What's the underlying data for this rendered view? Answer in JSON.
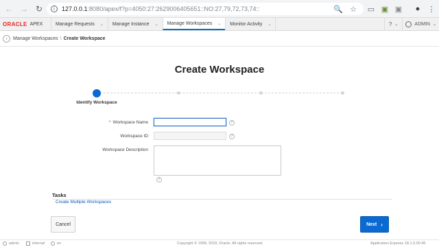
{
  "browser": {
    "back_icon": "arrow-left-icon",
    "back_glyph": "←",
    "forward_glyph": "→",
    "reload_glyph": "↻",
    "info_glyph": "i",
    "url_host": "127.0.0.1",
    "url_path": ":8080/apex/f?p=4050:27:2629006405651::NO:27,79,72,73,74::",
    "zoom_glyph": "🔍",
    "star_glyph": "☆",
    "cast_glyph": "▭",
    "ext1_glyph": "▣",
    "ext2_glyph": "▣",
    "account_glyph": "●",
    "menu_glyph": "⋮"
  },
  "header": {
    "logo_oracle": "ORACLE",
    "logo_apex": "APEX",
    "tabs": [
      {
        "label": "Manage Requests",
        "chevron": "⌄"
      },
      {
        "label": "Manage Instance",
        "chevron": "⌄"
      },
      {
        "label": "Manage Workspaces",
        "chevron": "⌄"
      },
      {
        "label": "Monitor Activity",
        "chevron": "⌄"
      }
    ],
    "active_tab_index": 2,
    "help_glyph": "?",
    "help_chevron": "⌄",
    "user_label": "ADMIN",
    "user_chevron": "⌄"
  },
  "breadcrumb": {
    "back_glyph": "‹",
    "parent": "Manage Workspaces",
    "separator": "\\",
    "current": "Create Workspace"
  },
  "page_title": "Create Workspace",
  "wizard": {
    "current_step_label": "Identify Workspace",
    "total_steps": 4,
    "current_step": 1
  },
  "form": {
    "required_mark": "*",
    "workspace_name_label": "Workspace Name",
    "workspace_name_value": "",
    "workspace_id_label": "Workspace ID",
    "workspace_id_value": "",
    "workspace_description_label": "Workspace Description",
    "help_glyph": "?"
  },
  "tasks": {
    "heading": "Tasks",
    "link": "Create Multiple Workspaces"
  },
  "buttons": {
    "cancel": "Cancel",
    "next": "Next",
    "next_arrow": "›"
  },
  "footer": {
    "user": "admin",
    "schema": "internal",
    "language": "en",
    "copyright": "Copyright © 1999, 2018, Oracle. All rights reserved.",
    "version": "Application Express 18.1.0.00.45"
  },
  "colors": {
    "accent": "#0a6ad2",
    "oracle_red": "#e42525",
    "required": "#d62c1a"
  }
}
